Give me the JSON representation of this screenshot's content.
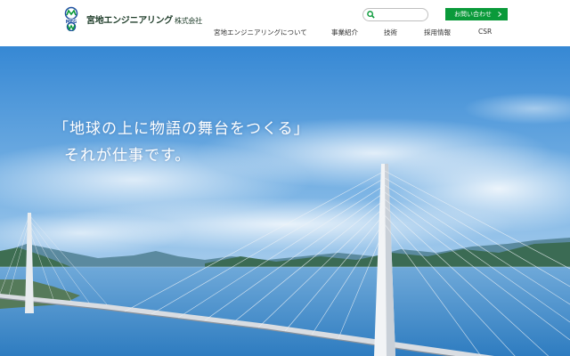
{
  "header": {
    "company_name": "宮地エンジニアリング",
    "company_suffix": "株式会社",
    "logo_text": "MEG",
    "search_placeholder": "",
    "inquiry_label": "お問い合わせ",
    "nav": [
      {
        "label": "宮地エンジニアリングについて"
      },
      {
        "label": "事業紹介"
      },
      {
        "label": "技術"
      },
      {
        "label": "採用情報"
      },
      {
        "label": "CSR"
      }
    ]
  },
  "hero": {
    "tagline_line1": "「地球の上に物語の舞台をつくる」",
    "tagline_line2": "それが仕事です。"
  },
  "colors": {
    "brand_green": "#0a9a3a",
    "logo_blue": "#1e4fa0",
    "sky_top": "#3f8fd6",
    "sea": "#3f8fc9"
  }
}
